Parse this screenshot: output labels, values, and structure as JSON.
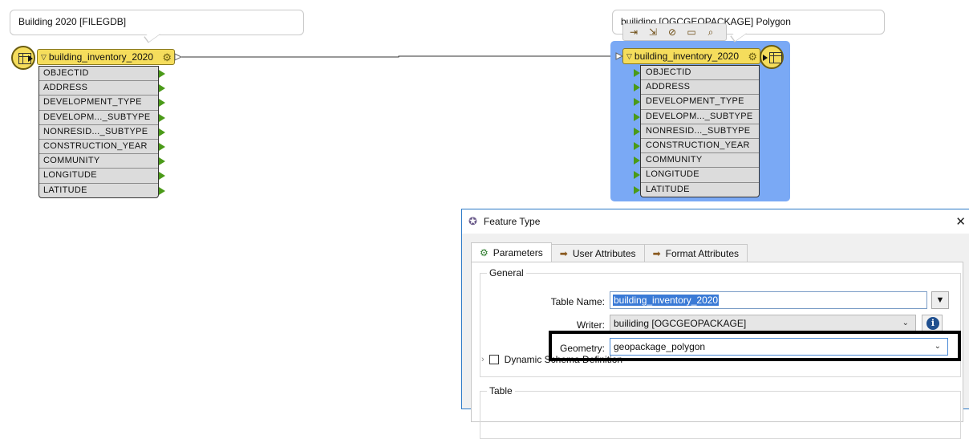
{
  "left_node": {
    "annotation": "Building 2020 [FILEGDB]",
    "name": "building_inventory_2020",
    "attributes": [
      "OBJECTID",
      "ADDRESS",
      "DEVELOPMENT_TYPE",
      "DEVELOPM..._SUBTYPE",
      "NONRESID..._SUBTYPE",
      "CONSTRUCTION_YEAR",
      "COMMUNITY",
      "LONGITUDE",
      "LATITUDE"
    ]
  },
  "right_node": {
    "annotation": "builiding [OGCGEOPACKAGE] Polygon",
    "name": "building_inventory_2020",
    "attributes": [
      "OBJECTID",
      "ADDRESS",
      "DEVELOPMENT_TYPE",
      "DEVELOPM..._SUBTYPE",
      "NONRESID..._SUBTYPE",
      "CONSTRUCTION_YEAR",
      "COMMUNITY",
      "LONGITUDE",
      "LATITUDE"
    ]
  },
  "dialog": {
    "title": "Feature Type",
    "tabs": [
      "Parameters",
      "User Attributes",
      "Format Attributes"
    ],
    "general_label": "General",
    "table_name_label": "Table Name:",
    "table_name_value": "building_inventory_2020",
    "writer_label": "Writer:",
    "writer_value": "builiding [OGCGEOPACKAGE]",
    "geometry_label": "Geometry:",
    "geometry_value": "geopackage_polygon",
    "dynamic_schema_label": "Dynamic Schema Definition",
    "table_group_label": "Table"
  },
  "colors": {
    "node_yellow": "#f5dd5c",
    "selection_blue": "#7aa9f5",
    "port_green": "#4a9a18"
  }
}
